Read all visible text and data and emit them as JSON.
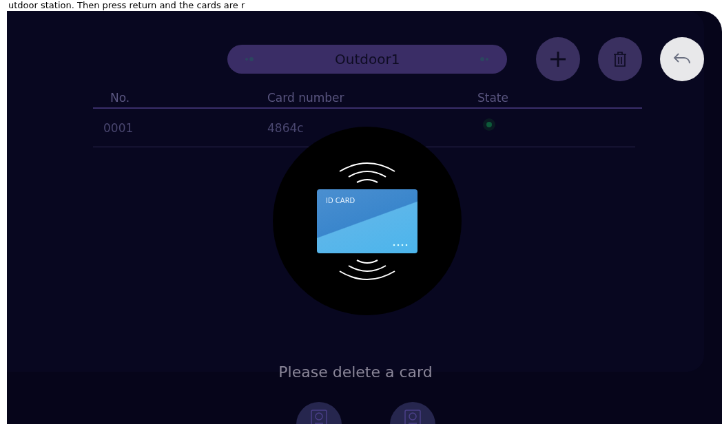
{
  "caption": "utdoor station. Then press return and the cards are r",
  "device_selector": {
    "label": "Outdoor1"
  },
  "table": {
    "columns": [
      "No.",
      "Card number",
      "State"
    ],
    "rows": [
      {
        "no": "0001",
        "card_number": "4864c",
        "on": true
      }
    ]
  },
  "dialog": {
    "card_label": "ID CARD",
    "message": "Please delete a card"
  },
  "door_stations": [
    {
      "kind": "station"
    },
    {
      "kind": "station"
    }
  ]
}
